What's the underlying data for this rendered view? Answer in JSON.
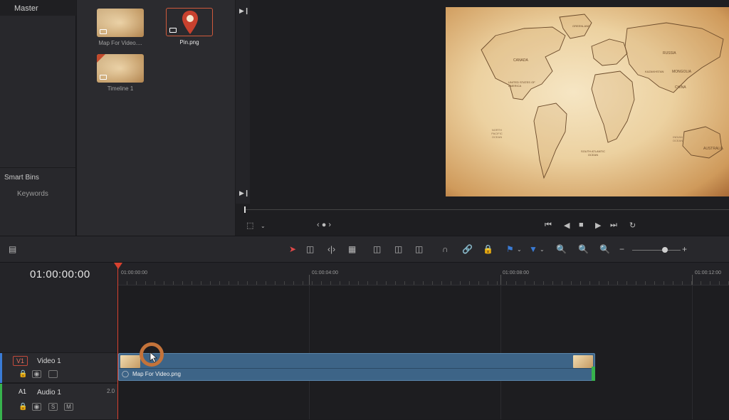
{
  "bins": {
    "master": "Master",
    "smart_bins": "Smart Bins",
    "keywords": "Keywords"
  },
  "media_pool": {
    "clips": [
      {
        "name": "Map For Video....",
        "type": "image"
      },
      {
        "name": "Pin.png",
        "type": "image",
        "selected": true
      },
      {
        "name": "Timeline 1",
        "type": "timeline"
      }
    ]
  },
  "map_labels": [
    {
      "text": "GREENLAND"
    },
    {
      "text": "CANADA"
    },
    {
      "text": "UNITED STATES OF AMERICA"
    },
    {
      "text": "RUSSIA"
    },
    {
      "text": "MONGOLIA"
    },
    {
      "text": "CHINA"
    },
    {
      "text": "KAZAKHSTAN"
    },
    {
      "text": "NORTH PACIFIC OCEAN"
    },
    {
      "text": "SOUTH ATLANTIC OCEAN"
    },
    {
      "text": "INDIAN OCEAN"
    },
    {
      "text": "AUSTRALIA"
    }
  ],
  "timeline": {
    "timecode": "01:00:00:00",
    "ruler_labels": [
      {
        "text": "01:00:00:00"
      },
      {
        "text": "01:00:04:00"
      },
      {
        "text": "01:00:08:00"
      },
      {
        "text": "01:00:12:00"
      }
    ],
    "tracks": {
      "video": {
        "tag": "V1",
        "name": "Video 1"
      },
      "audio": {
        "tag": "A1",
        "name": "Audio 1",
        "channels": "2.0"
      }
    },
    "clip": {
      "name": "Map For Video.png"
    }
  },
  "buttons": {
    "solo": "S",
    "mute": "M"
  },
  "colors": {
    "playhead": "#d8412f",
    "clip": "#3d6487",
    "accent_blue": "#3a7bd5",
    "audio_green": "#37b24d",
    "selection": "#d05a3c"
  }
}
